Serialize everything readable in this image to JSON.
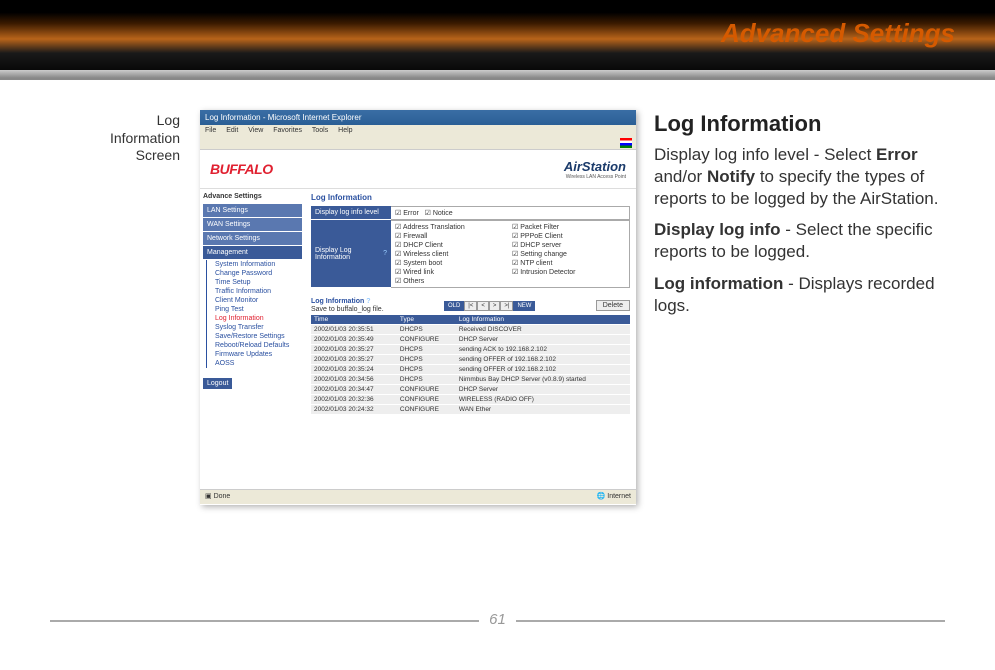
{
  "banner": {
    "title": "Advanced Settings"
  },
  "caption": {
    "line1": "Log",
    "line2": "Information",
    "line3": "Screen"
  },
  "screenshot": {
    "window_title": "Log Information - Microsoft Internet Explorer",
    "menu": [
      "File",
      "Edit",
      "View",
      "Favorites",
      "Tools",
      "Help"
    ],
    "brand_left": "BUFFALO",
    "brand_right": "AirStation",
    "brand_right_sub": "Wireless LAN Access Point",
    "sidebar": {
      "heading": "Advance Settings",
      "top_items": [
        "LAN Settings",
        "WAN Settings",
        "Network Settings"
      ],
      "management_label": "Management",
      "sub_items": [
        "System Information",
        "Change Password",
        "Time Setup",
        "Traffic Information",
        "Client Monitor",
        "Ping Test",
        "Log Information",
        "Syslog Transfer",
        "Save/Restore Settings",
        "Reboot/Reload Defaults",
        "Firmware Updates",
        "AOSS"
      ],
      "selected_sub": "Log Information",
      "logout": "Logout"
    },
    "main_title": "Log Information",
    "level_row_label": "Display log info level",
    "level_opts": [
      "Error",
      "Notice"
    ],
    "info_row_label": "Display Log Information",
    "info_help": "?",
    "info_opts": [
      "Address Translation",
      "Packet Filter",
      "Firewall",
      "PPPoE Client",
      "DHCP Client",
      "DHCP server",
      "Wireless client",
      "Setting change",
      "System boot",
      "NTP client",
      "Wired link",
      "Intrusion Detector",
      "Others",
      ""
    ],
    "log_table_title": "Log Information",
    "log_file_note": "Save to buffalo_log file.",
    "pager_old": "OLD",
    "pager_new": "NEW",
    "delete_label": "Delete",
    "columns": [
      "Time",
      "Type",
      "Log Information"
    ],
    "rows": [
      [
        "2002/01/03 20:35:51",
        "DHCPS",
        "Received DISCOVER"
      ],
      [
        "2002/01/03 20:35:49",
        "CONFIGURE",
        "DHCP Server"
      ],
      [
        "2002/01/03 20:35:27",
        "DHCPS",
        "sending ACK to 192.168.2.102"
      ],
      [
        "2002/01/03 20:35:27",
        "DHCPS",
        "sending OFFER of 192.168.2.102"
      ],
      [
        "2002/01/03 20:35:24",
        "DHCPS",
        "sending OFFER of 192.168.2.102"
      ],
      [
        "2002/01/03 20:34:56",
        "DHCPS",
        "Nimmbus Bay DHCP Server (v0.8.9) started"
      ],
      [
        "2002/01/03 20:34:47",
        "CONFIGURE",
        "DHCP Server"
      ],
      [
        "2002/01/03 20:32:36",
        "CONFIGURE",
        "WIRELESS (RADIO OFF)"
      ],
      [
        "2002/01/03 20:24:32",
        "CONFIGURE",
        "WAN Ether"
      ]
    ],
    "status_left": "Done",
    "status_right": "Internet"
  },
  "rightcol": {
    "heading": "Log Information",
    "p1a": "Display log info level - Select ",
    "p1b": "Error",
    "p1c": " and/or ",
    "p1d": "Notify",
    "p1e": " to specify the types of reports to be logged by the AirStation.",
    "p2a": "Display log info",
    "p2b": " - Select the specific reports to be logged.",
    "p3a": "Log information",
    "p3b": " - Displays recorded logs."
  },
  "page_number": "61"
}
